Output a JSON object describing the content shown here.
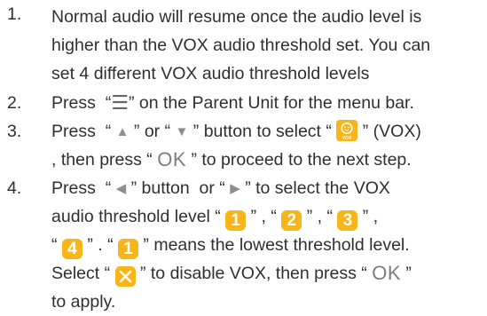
{
  "items": [
    {
      "number": "1.",
      "lines": [
        "Normal audio will resume once the audio level is",
        "higher than the VOX audio threshold set. You can",
        "set 4 different VOX audio threshold levels"
      ]
    },
    {
      "number": "2.",
      "press": "Press",
      "menu_symbol": "☰",
      "rest": "on the Parent Unit for the menu bar."
    },
    {
      "number": "3.",
      "press": "Press",
      "up_symbol": "▲",
      "or": "or",
      "down_symbol": "▼",
      "rest1": "button to select",
      "vox_label": "(VOX)",
      "line2_a": ", then press",
      "ok_symbol": "OK",
      "line2_b": "to proceed to the next step.",
      "vox_icon_text": "VOX"
    },
    {
      "number": "4.",
      "press": "Press",
      "left_symbol": "◀",
      "mid": "button  or",
      "right_symbol": "▶",
      "rest1": "to select the VOX",
      "line2": "audio threshold level",
      "levels": [
        "1",
        "2",
        "3",
        "4"
      ],
      "means": "means the lowest threshold level.",
      "select": "Select",
      "disable": "to disable VOX, then press",
      "ok_symbol": "OK",
      "to_apply": "to apply.",
      "disable_icon": "close-icon"
    }
  ],
  "colors": {
    "badge": "#f7b51a",
    "text": "#2f2f2f"
  }
}
